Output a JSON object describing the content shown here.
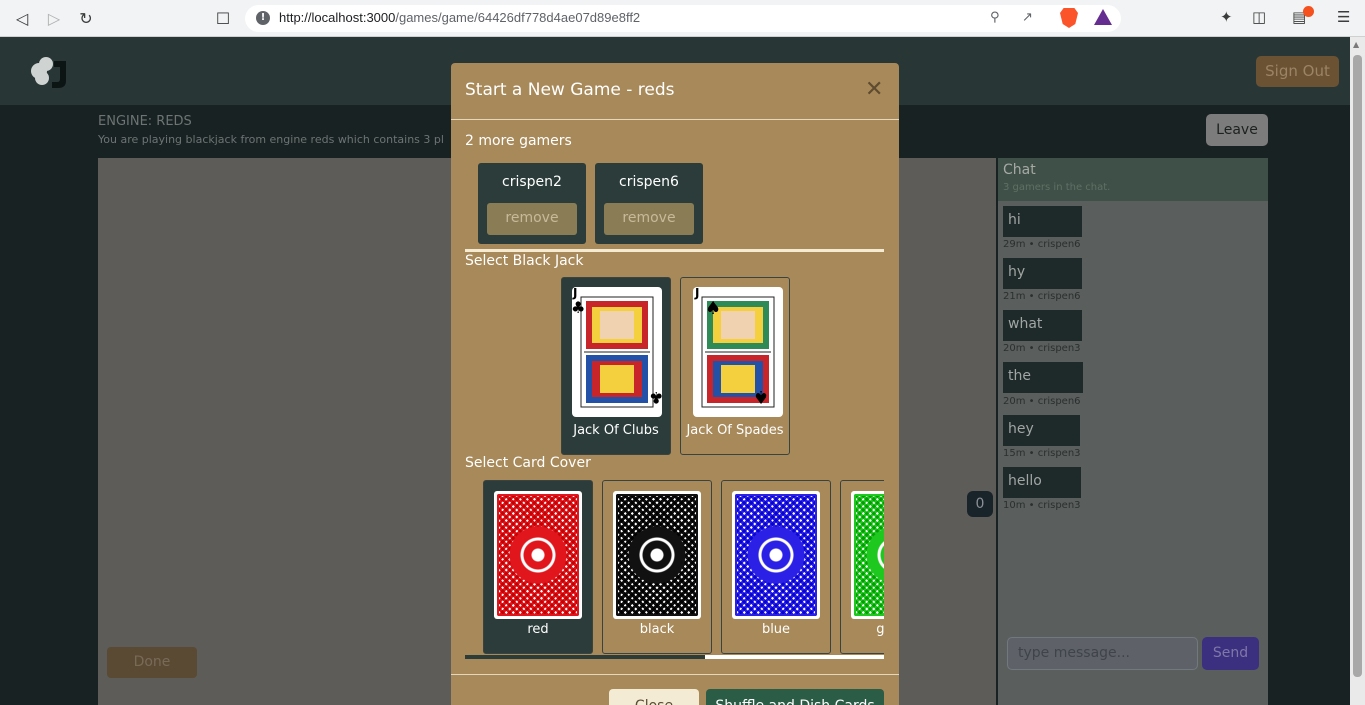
{
  "browser": {
    "url_host": "http://localhost:3000",
    "url_path": "/games/game/64426df778d4ae07d89e8ff2"
  },
  "header": {
    "sign_out_label": "Sign Out"
  },
  "engine": {
    "title": "ENGINE: REDS",
    "description": "You are playing blackjack from engine reds which contains 3 pl"
  },
  "leave_label": "Leave",
  "done_label": "Done",
  "badge_count": "0",
  "chat": {
    "title": "Chat",
    "subtitle": "3 gamers in the chat.",
    "messages": [
      {
        "text": "hi",
        "meta": "29m • crispen6"
      },
      {
        "text": "hy",
        "meta": "21m • crispen6"
      },
      {
        "text": "what",
        "meta": "20m • crispen3"
      },
      {
        "text": "the",
        "meta": "20m • crispen6"
      },
      {
        "text": "hey",
        "meta": "15m • crispen3"
      },
      {
        "text": "hello",
        "meta": "10m • crispen3"
      }
    ],
    "input_placeholder": "type message...",
    "send_label": "Send"
  },
  "modal": {
    "title": "Start a New Game - reds",
    "gamers_heading": "2 more gamers",
    "gamers": [
      {
        "name": "crispen2",
        "remove_label": "remove"
      },
      {
        "name": "crispen6",
        "remove_label": "remove"
      }
    ],
    "select_jack_label": "Select Black Jack",
    "jacks": [
      {
        "label": "Jack Of Clubs",
        "rank": "J",
        "suit": "♣",
        "selected": true
      },
      {
        "label": "Jack Of Spades",
        "rank": "J",
        "suit": "♠",
        "selected": false
      }
    ],
    "select_cover_label": "Select Card Cover",
    "covers": [
      {
        "label": "red",
        "color": "#e0161c",
        "selected": true
      },
      {
        "label": "black",
        "color": "#111111",
        "selected": false
      },
      {
        "label": "blue",
        "color": "#2b20e6",
        "selected": false
      },
      {
        "label": "green",
        "color": "#1fc81f",
        "selected": false
      }
    ],
    "close_label": "Close",
    "shuffle_label": "Shuffle and Dish Cards"
  },
  "colors": {
    "modal_bg": "#a8895a",
    "selected_card_bg": "#2b3c3a",
    "header_bg": "#293636"
  }
}
